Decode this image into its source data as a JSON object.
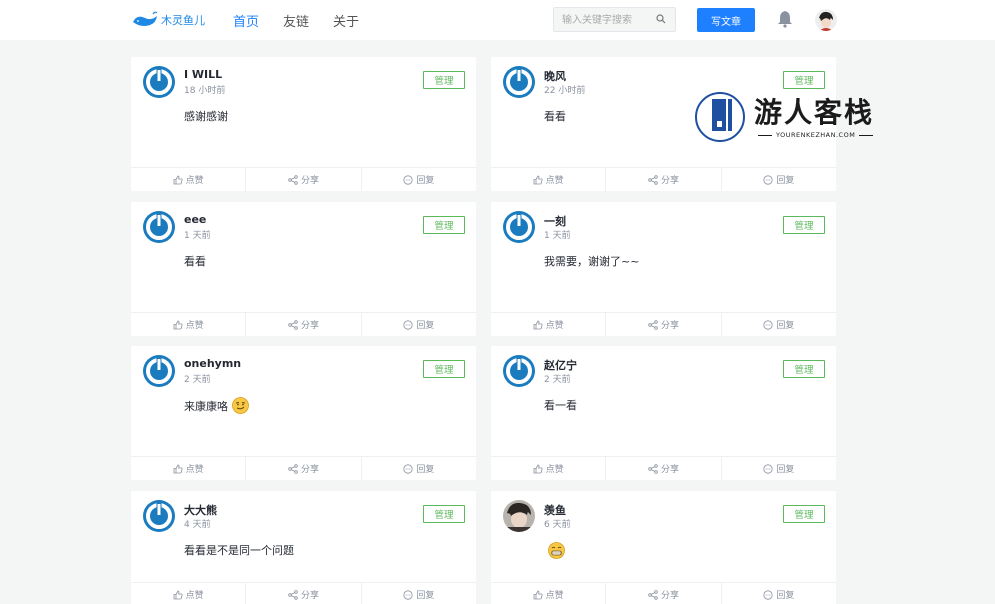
{
  "header": {
    "logo_text": "木灵鱼儿",
    "nav": [
      "首页",
      "友链",
      "关于"
    ],
    "search_placeholder": "输入关键字搜索",
    "write_label": "写文章"
  },
  "actions": {
    "like": "点赞",
    "share": "分享",
    "reply": "回复"
  },
  "manage_label": "管理",
  "comments": [
    {
      "name": "I WILL",
      "time": "18 小时前",
      "text": "感谢感谢"
    },
    {
      "name": "晚风",
      "time": "22 小时前",
      "text": "看看"
    },
    {
      "name": "eee",
      "time": "1 天前",
      "text": "看看"
    },
    {
      "name": "一刻",
      "time": "1 天前",
      "text": "我需要，谢谢了~~"
    },
    {
      "name": "onehymn",
      "time": "2 天前",
      "text": "来康康咯",
      "emoji": "smirk-emoji"
    },
    {
      "name": "赵亿宁",
      "time": "2 天前",
      "text": "看一看"
    },
    {
      "name": "大大熊",
      "time": "4 天前",
      "text": "看看是不是同一个问题"
    },
    {
      "name": "羡鱼",
      "time": "6 天前",
      "text": "",
      "emoji": "grin-emoji"
    }
  ],
  "watermark": {
    "title": "游人客栈",
    "subtitle": "YOURENKEZHAN.COM"
  },
  "colors": {
    "accent": "#1e80ff",
    "manage": "#5cb85c",
    "avatar": "#1a7bbf"
  }
}
